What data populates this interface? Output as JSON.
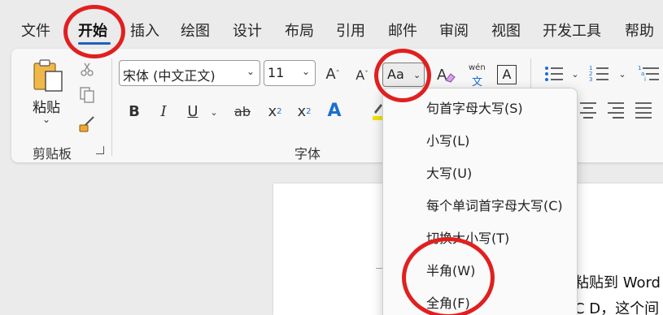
{
  "tabs": [
    {
      "label": "文件"
    },
    {
      "label": "开始"
    },
    {
      "label": "插入"
    },
    {
      "label": "绘图"
    },
    {
      "label": "设计"
    },
    {
      "label": "布局"
    },
    {
      "label": "引用"
    },
    {
      "label": "邮件"
    },
    {
      "label": "审阅"
    },
    {
      "label": "视图"
    },
    {
      "label": "开发工具"
    },
    {
      "label": "帮助"
    }
  ],
  "clipboard": {
    "paste_label": "粘贴",
    "group_label": "剪贴板"
  },
  "font": {
    "font_name": "宋体 (中文正文)",
    "font_size": "11",
    "case_button_label": "Aa",
    "wen_label": "wén",
    "wen_char": "文",
    "bordered_char": "A",
    "group_label": "字体"
  },
  "change_case_menu": {
    "items": [
      {
        "label": "句首字母大写(S)"
      },
      {
        "label": "小写(L)"
      },
      {
        "label": "大写(U)"
      },
      {
        "label": "每个单词首字母大写(C)"
      },
      {
        "label": "切换大小写(T)"
      },
      {
        "label": "半角(W)"
      },
      {
        "label": "全角(F)"
      }
    ]
  },
  "document": {
    "line1": "粘贴到 Word",
    "line2": "C D，这个间"
  },
  "colors": {
    "annotation": "#e02020",
    "active_tab_underline": "#1f5fbf",
    "text_effect_blue": "#1a6fd1",
    "highlighter_yellow": "#f2e400"
  }
}
